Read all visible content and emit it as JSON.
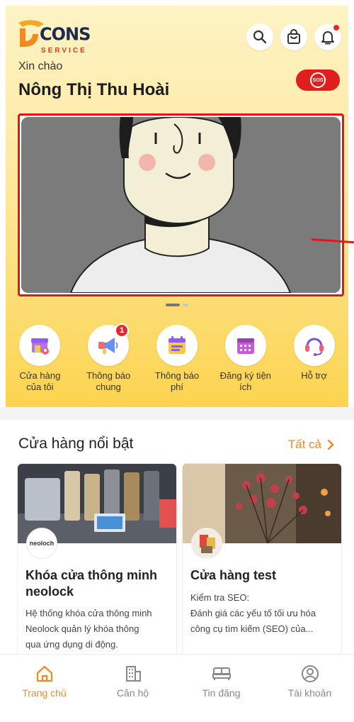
{
  "logo": {
    "brand": "CONS",
    "sub": "SERVICE"
  },
  "header": {
    "greeting": "Xin chào",
    "user_name": "Nông Thị Thu Hoài",
    "sos_label": "SOS"
  },
  "icons": {
    "search": "search-icon",
    "cart": "shopping-bag-icon",
    "notification": "bell-icon"
  },
  "banner": {
    "slide_count": 2,
    "active_slide": 1
  },
  "features": [
    {
      "line1": "Cửa hàng",
      "line2": "của tôi",
      "icon": "store-icon",
      "badge": ""
    },
    {
      "line1": "Thông báo",
      "line2": "chung",
      "icon": "megaphone-icon",
      "badge": "1"
    },
    {
      "line1": "Thông báo",
      "line2": "phí",
      "icon": "invoice-icon",
      "badge": ""
    },
    {
      "line1": "Đăng ký tiện",
      "line2": "ích",
      "icon": "calendar-icon",
      "badge": ""
    },
    {
      "line1": "Hỗ trợ",
      "line2": "",
      "icon": "headset-icon",
      "badge": ""
    }
  ],
  "featured": {
    "title": "Cửa hàng nổi bật",
    "see_all": "Tất cả",
    "stores": [
      {
        "name_line1": "Khóa cửa thông minh",
        "name_line2": "neolock",
        "avatar_text": "neoloch",
        "desc": [
          "Hệ thống khóa cửa thông minh",
          "Neolock quản lý khóa thông",
          "qua ứng dụng di động."
        ]
      },
      {
        "name_line1": "Cửa hàng test",
        "name_line2": "",
        "avatar_text": "",
        "desc": [
          "Kiểm tra SEO:",
          "Đánh giá các yếu tố tối ưu hóa",
          "công cụ tìm kiếm (SEO) của..."
        ]
      }
    ]
  },
  "tabs": [
    {
      "label": "Trang chủ",
      "icon": "home-icon",
      "active": true
    },
    {
      "label": "Căn hộ",
      "icon": "building-icon",
      "active": false
    },
    {
      "label": "Tin đăng",
      "icon": "bed-icon",
      "active": false
    },
    {
      "label": "Tài khoản",
      "icon": "user-icon",
      "active": false
    }
  ],
  "colors": {
    "accent": "#f28a1f",
    "sos": "#e01e1e",
    "hero_top": "#fdf3c4",
    "hero_bottom": "#fcd44f"
  }
}
